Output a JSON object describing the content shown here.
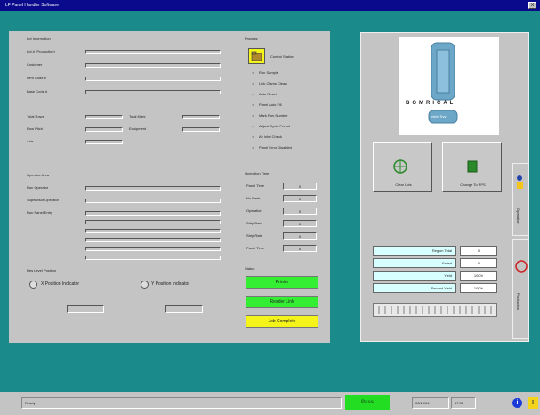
{
  "window": {
    "title": "LF Panel Handler Software",
    "close_label": "X"
  },
  "lot_info": {
    "heading": "Lot Information",
    "fields": [
      {
        "label": "Lot # (Production)"
      },
      {
        "label": "Customer"
      },
      {
        "label": "Item Code #"
      },
      {
        "label": "Base Code #"
      }
    ],
    "mid_left": [
      {
        "label": "Total Rows"
      },
      {
        "label": "Row Pitch"
      },
      {
        "label": "Axis"
      }
    ],
    "mid_right": [
      {
        "label": "Total Mark"
      },
      {
        "label": "Equipment"
      }
    ]
  },
  "operation": {
    "heading": "Operator Area",
    "fields": [
      {
        "label": "Run Operator"
      },
      {
        "label": "Supervisor Operator"
      },
      {
        "label": "Run Panel Entry"
      }
    ]
  },
  "res_level": {
    "heading": "Res Level Position",
    "options": [
      {
        "label": "X Position Indicator"
      },
      {
        "label": "Y Position Indicator"
      }
    ]
  },
  "options_group": {
    "heading": "Process",
    "button_label": "Control Station",
    "checks": [
      {
        "label": "Run Sample"
      },
      {
        "label": "Link Clamp Clean"
      },
      {
        "label": "Auto Reset"
      },
      {
        "label": "Panel Auto Fill"
      },
      {
        "label": "Mark Run Number"
      },
      {
        "label": "Adjust Cycle Period"
      },
      {
        "label": "Air Inlet Check"
      },
      {
        "label": "Panel Error Disabled"
      }
    ]
  },
  "operation_time": {
    "heading": "Operation Time",
    "rows": [
      {
        "label": "Panel Time",
        "value": "0"
      },
      {
        "label": "No Parts",
        "value": "0"
      },
      {
        "label": "Operation",
        "value": "0"
      },
      {
        "label": "Strip Part",
        "value": "0"
      },
      {
        "label": "Strip Rate",
        "value": "0"
      },
      {
        "label": "Panel Time",
        "value": "0"
      }
    ]
  },
  "status_group": {
    "heading": "Status",
    "buttons": [
      {
        "label": "Printer",
        "color": "#33ee33"
      },
      {
        "label": "Reader Link",
        "color": "#33ee33"
      },
      {
        "label": "Job Complete",
        "color": "#f4f41a"
      }
    ]
  },
  "right_panel": {
    "logo_text": "BOMRICAL",
    "logo_sub": "Inkjet Sys",
    "big_buttons": [
      {
        "label": "Clear Lots",
        "icon": "fan-icon"
      },
      {
        "label": "Change To PPS",
        "icon": "document-icon"
      }
    ],
    "side_tabs": [
      {
        "label": "Operation"
      },
      {
        "label": "Production"
      }
    ],
    "yield_rows": [
      {
        "label": "Region Total",
        "value": "0"
      },
      {
        "label": "Failed",
        "value": "0"
      },
      {
        "label": "Yield",
        "value": "100%"
      },
      {
        "label": "Second Yield",
        "value": "100%"
      }
    ]
  },
  "statusbar": {
    "left_text": "Ready",
    "pass_label": "Pass",
    "pass_color": "#22dd22",
    "date": "03/16/04",
    "time": "17:31",
    "info_icon": "info-icon",
    "warn_icon": "warning-icon"
  },
  "colors": {
    "background": "#1a8a8a",
    "titlebar": "#0a0a8c",
    "panel": "#c4c4c4"
  }
}
